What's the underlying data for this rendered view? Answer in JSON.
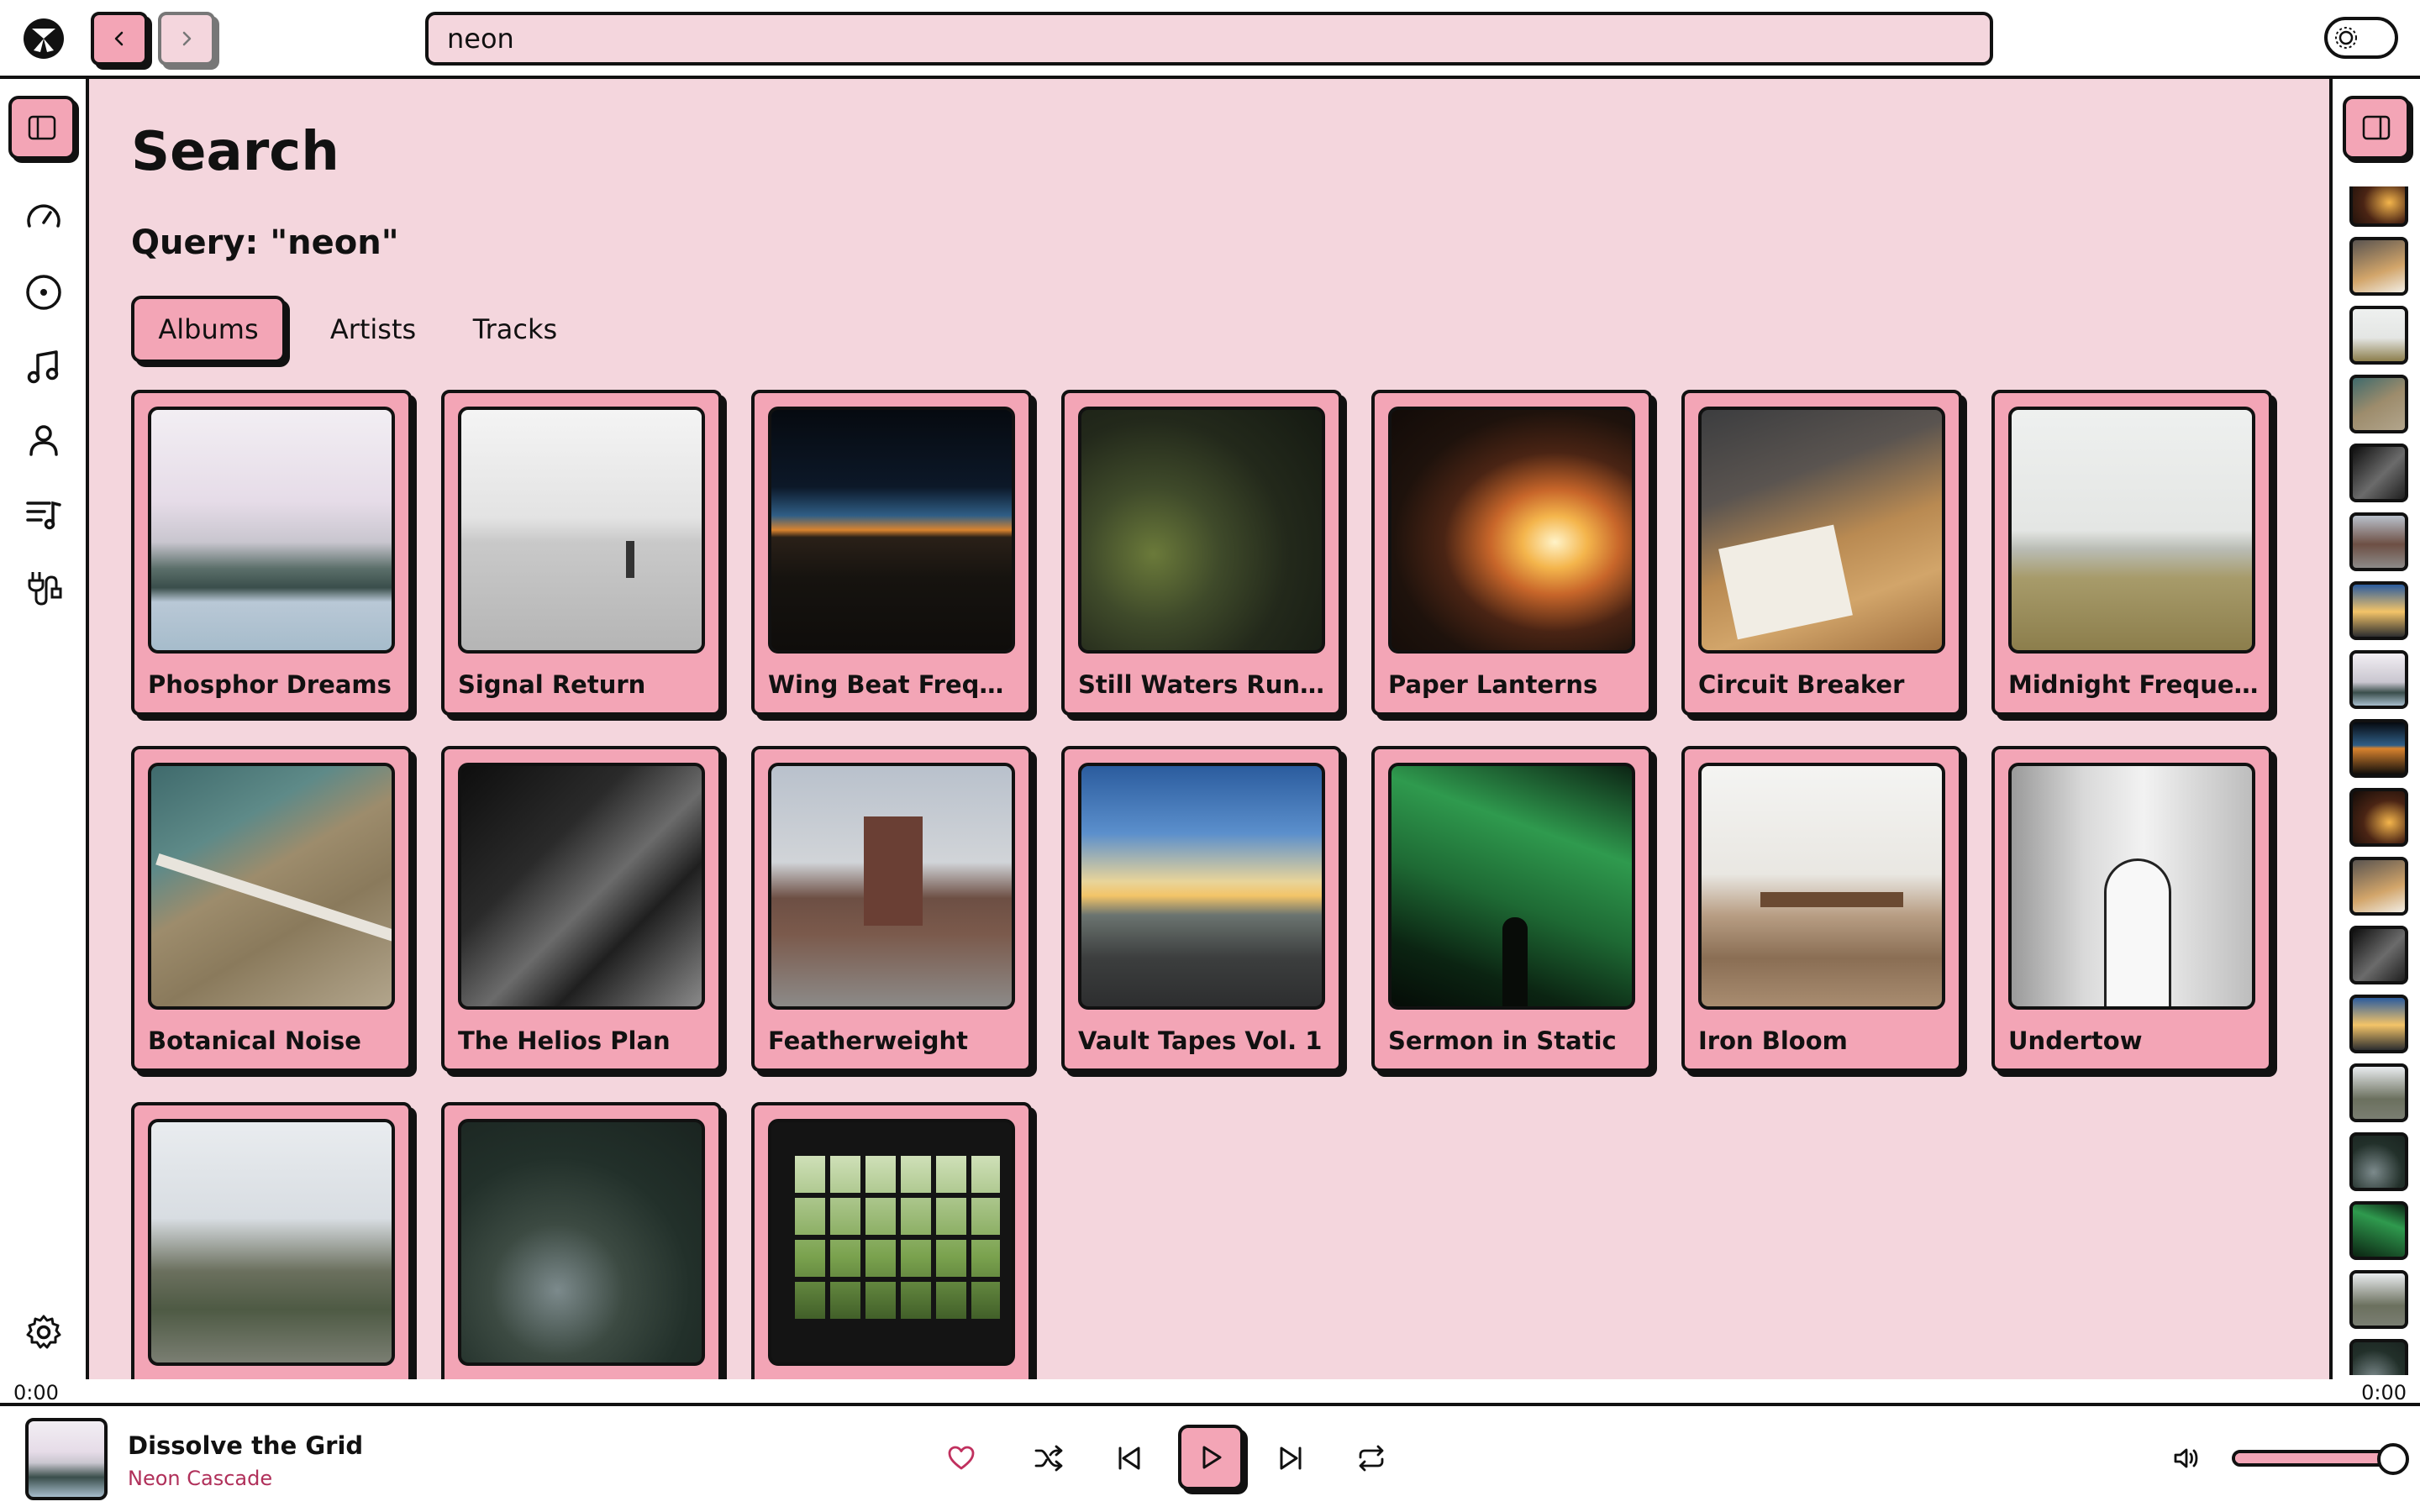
{
  "colors": {
    "accent": "#f3a5b6",
    "panel": "#f4d6dd",
    "ink": "#111111",
    "artist_text": "#b0305a"
  },
  "topbar": {
    "search_value": "neon",
    "icons": [
      "app-logo-icon",
      "chevron-left-icon",
      "chevron-right-icon",
      "theme-toggle-icon"
    ]
  },
  "sidebar": {
    "items": [
      {
        "name": "dashboard",
        "icon": "gauge-icon"
      },
      {
        "name": "albums",
        "icon": "disc-icon"
      },
      {
        "name": "tracks",
        "icon": "music-note-icon"
      },
      {
        "name": "artists",
        "icon": "user-icon"
      },
      {
        "name": "playlists",
        "icon": "playlist-icon"
      },
      {
        "name": "settings",
        "icon": "gear-icon"
      }
    ]
  },
  "main": {
    "title": "Search",
    "query_label": "Query: \"neon\"",
    "tabs": [
      {
        "label": "Albums",
        "active": true
      },
      {
        "label": "Artists",
        "active": false
      },
      {
        "label": "Tracks",
        "active": false
      }
    ],
    "albums": [
      {
        "title": "Phosphor Dreams",
        "art": "misty-lake"
      },
      {
        "title": "Signal Return",
        "art": "foggy-sea"
      },
      {
        "title": "Wing Beat Frequency",
        "art": "dusk-horizon"
      },
      {
        "title": "Still Waters Run Code",
        "art": "mossy-trunk"
      },
      {
        "title": "Paper Lanterns",
        "art": "campfire"
      },
      {
        "title": "Circuit Breaker",
        "art": "desk-notes"
      },
      {
        "title": "Midnight Frequencies",
        "art": "dune-grass"
      },
      {
        "title": "Botanical Noise",
        "art": "highway-aerial"
      },
      {
        "title": "The Helios Plan",
        "art": "skyscraper-bw"
      },
      {
        "title": "Featherweight",
        "art": "bridge-cables"
      },
      {
        "title": "Vault Tapes Vol. 1",
        "art": "sunset-road"
      },
      {
        "title": "Sermon in Static",
        "art": "aurora"
      },
      {
        "title": "Iron Bloom",
        "art": "dining-room"
      },
      {
        "title": "Undertow",
        "art": "subway-bw"
      },
      {
        "title": "",
        "art": "mountain-mist"
      },
      {
        "title": "",
        "art": "forest-aerial"
      },
      {
        "title": "",
        "art": "window-trees"
      }
    ]
  },
  "queue": {
    "thumbs": [
      "campfire",
      "desk-notes",
      "dune-grass",
      "highway-aerial",
      "skyscraper-bw",
      "bridge-cables",
      "sunset-road",
      "misty-lake",
      "dusk-horizon",
      "campfire",
      "desk-notes",
      "skyscraper-bw",
      "sunset-road",
      "mountain-mist",
      "forest-aerial",
      "aurora",
      "mountain-mist",
      "forest-aerial"
    ]
  },
  "progress": {
    "elapsed": "0:00",
    "total": "0:00"
  },
  "player": {
    "title": "Dissolve the Grid",
    "artist": "Neon Cascade",
    "volume": 1.0,
    "icons": [
      "heart-icon",
      "shuffle-icon",
      "skip-back-icon",
      "play-icon",
      "skip-forward-icon",
      "repeat-icon",
      "volume-icon"
    ]
  }
}
